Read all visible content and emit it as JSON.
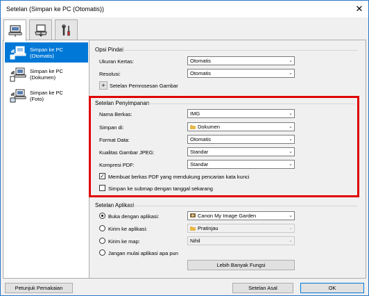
{
  "window": {
    "title": "Setelan (Simpan ke PC (Otomatis))",
    "close_glyph": "✕"
  },
  "tabs": [
    {
      "icon": "computer-icon"
    },
    {
      "icon": "scanner-icon"
    },
    {
      "icon": "tools-icon"
    }
  ],
  "sidebar": {
    "items": [
      {
        "label": "Simpan ke PC\n(Otomatis)",
        "icon": "save-to-pc-icon",
        "selected": true
      },
      {
        "label": "Simpan ke PC\n(Dokumen)",
        "icon": "save-to-pc-icon",
        "selected": false
      },
      {
        "label": "Simpan ke PC\n(Foto)",
        "icon": "save-to-pc-icon",
        "selected": false
      }
    ]
  },
  "scan_options": {
    "title": "Opsi Pindai",
    "paper_size_label": "Ukuran Kertas:",
    "paper_size_value": "Otomatis",
    "resolution_label": "Resolusi:",
    "resolution_value": "Otomatis",
    "image_processing_label": "Setelan Pemrosesan Gambar",
    "expand_glyph": "+"
  },
  "save_settings": {
    "title": "Setelan Penyimpanan",
    "file_name_label": "Nama Berkas:",
    "file_name_value": "IMG",
    "save_in_label": "Simpan di:",
    "save_in_value": "Dokumen",
    "data_format_label": "Format Data:",
    "data_format_value": "Otomatis",
    "jpeg_quality_label": "Kualitas Gambar JPEG:",
    "jpeg_quality_value": "Standar",
    "pdf_compression_label": "Kompresi PDF:",
    "pdf_compression_value": "Standar",
    "keyword_pdf_label": "Membuat berkas PDF yang mendukung pencarian kata kunci",
    "keyword_pdf_checked": true,
    "subfolder_label": "Simpan ke submap dengan tanggal sekarang",
    "subfolder_checked": false
  },
  "app_settings": {
    "title": "Setelan Aplikasi",
    "open_with_label": "Buka dengan aplikasi:",
    "open_with_value": "Canon My Image Garden",
    "send_to_app_label": "Kirim ke aplikasi:",
    "send_to_app_value": "Pratinjau",
    "send_to_folder_label": "Kirim ke map:",
    "send_to_folder_value": "Nihil",
    "do_not_start_label": "Jangan mulai aplikasi apa pun",
    "selected_option": "open_with",
    "more_functions_label": "Lebih Banyak Fungsi"
  },
  "footer": {
    "help_label": "Petunjuk Pemakaian",
    "defaults_label": "Setelan Asal",
    "ok_label": "OK"
  },
  "colors": {
    "accent": "#0078d7",
    "highlight": "#e00000"
  }
}
